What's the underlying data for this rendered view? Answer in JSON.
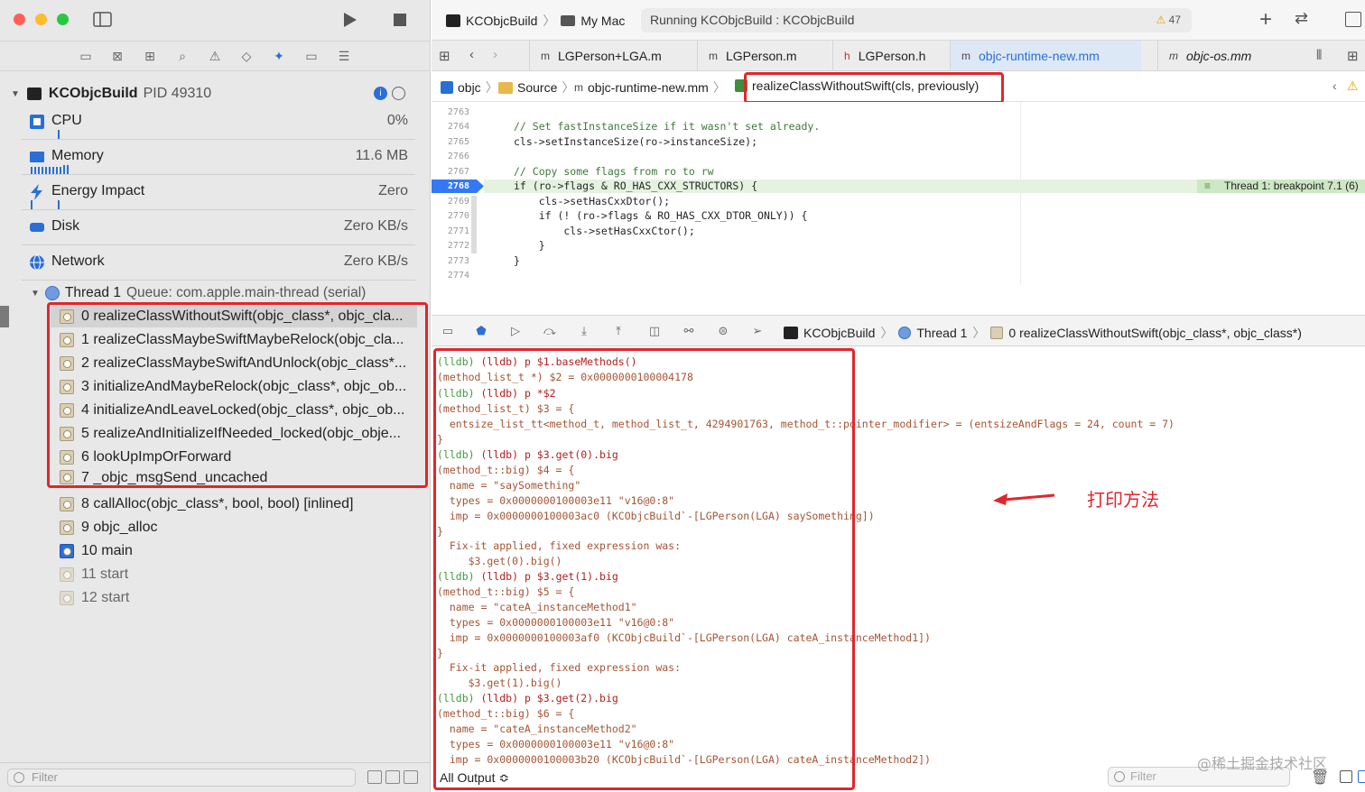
{
  "toolbar": {
    "scheme": "KCObjcBuild",
    "destination": "My Mac",
    "status": "Running KCObjcBuild : KCObjcBuild",
    "warnings": "47"
  },
  "process": {
    "name": "KCObjcBuild",
    "pid": "PID 49310"
  },
  "gauges": [
    {
      "label": "CPU",
      "value": "0%"
    },
    {
      "label": "Memory",
      "value": "11.6 MB"
    },
    {
      "label": "Energy Impact",
      "value": "Zero"
    },
    {
      "label": "Disk",
      "value": "Zero KB/s"
    },
    {
      "label": "Network",
      "value": "Zero KB/s"
    }
  ],
  "thread": {
    "label": "Thread 1",
    "queue": "Queue: com.apple.main-thread (serial)"
  },
  "frames": [
    "0 realizeClassWithoutSwift(objc_class*, objc_cla...",
    "1 realizeClassMaybeSwiftMaybeRelock(objc_cla...",
    "2 realizeClassMaybeSwiftAndUnlock(objc_class*...",
    "3 initializeAndMaybeRelock(objc_class*, objc_ob...",
    "4 initializeAndLeaveLocked(objc_class*, objc_ob...",
    "5 realizeAndInitializeIfNeeded_locked(objc_obje...",
    "6 lookUpImpOrForward",
    "7 _objc_msgSend_uncached",
    "8 callAlloc(objc_class*, bool, bool) [inlined]",
    "9 objc_alloc",
    "10 main",
    "11 start",
    "12 start"
  ],
  "left_filter": "Filter",
  "tabs": [
    "LGPerson+LGA.m",
    "LGPerson.m",
    "LGPerson.h",
    "objc-runtime-new.mm",
    "objc-os.mm"
  ],
  "tab_prefixes": [
    "m",
    "m",
    "h",
    "m",
    "m"
  ],
  "jumpbar": {
    "items": [
      "objc",
      "Source",
      "objc-runtime-new.mm",
      "realizeClassWithoutSwift(cls, previously)"
    ]
  },
  "code": {
    "line_numbers": [
      "2763",
      "2764",
      "2765",
      "2766",
      "2767",
      "2768",
      "2769",
      "2770",
      "2771",
      "2772",
      "2773",
      "2774"
    ],
    "lines": [
      "",
      "// Set fastInstanceSize if it wasn't set already.",
      "cls->setInstanceSize(ro->instanceSize);",
      "",
      "// Copy some flags from ro to rw",
      "if (ro->flags & RO_HAS_CXX_STRUCTORS) {",
      "    cls->setHasCxxDtor();",
      "    if (! (ro->flags & RO_HAS_CXX_DTOR_ONLY)) {",
      "        cls->setHasCxxCtor();",
      "    }",
      "}",
      ""
    ],
    "breakpoint_label": "Thread 1: breakpoint 7.1 (6)"
  },
  "debugbar": {
    "scheme": "KCObjcBuild",
    "thread": "Thread 1",
    "frame": "0 realizeClassWithoutSwift(objc_class*, objc_class*)"
  },
  "console": {
    "lines": [
      "(lldb) p $1.baseMethods()",
      "(method_list_t *) $2 = 0x0000000100004178",
      "(lldb) p *$2",
      "(method_list_t) $3 = {",
      "  entsize_list_tt<method_t, method_list_t, 4294901763, method_t::pointer_modifier> = (entsizeAndFlags = 24, count = 7)",
      "}",
      "(lldb) p $3.get(0).big",
      "(method_t::big) $4 = {",
      "  name = \"saySomething\"",
      "  types = 0x0000000100003e11 \"v16@0:8\"",
      "  imp = 0x0000000100003ac0 (KCObjcBuild`-[LGPerson(LGA) saySomething])",
      "}",
      "  Fix-it applied, fixed expression was:",
      "     $3.get(0).big()",
      "(lldb) p $3.get(1).big",
      "(method_t::big) $5 = {",
      "  name = \"cateA_instanceMethod1\"",
      "  types = 0x0000000100003e11 \"v16@0:8\"",
      "  imp = 0x0000000100003af0 (KCObjcBuild`-[LGPerson(LGA) cateA_instanceMethod1])",
      "}",
      "  Fix-it applied, fixed expression was:",
      "     $3.get(1).big()",
      "(lldb) p $3.get(2).big",
      "(method_t::big) $6 = {",
      "  name = \"cateA_instanceMethod2\"",
      "  types = 0x0000000100003e11 \"v16@0:8\"",
      "  imp = 0x0000000100003b20 (KCObjcBuild`-[LGPerson(LGA) cateA_instanceMethod2])"
    ],
    "output_selector": "All Output ≎",
    "filter_placeholder": "Filter"
  },
  "annotation": "打印方法",
  "watermark": "@稀土掘金技术社区"
}
